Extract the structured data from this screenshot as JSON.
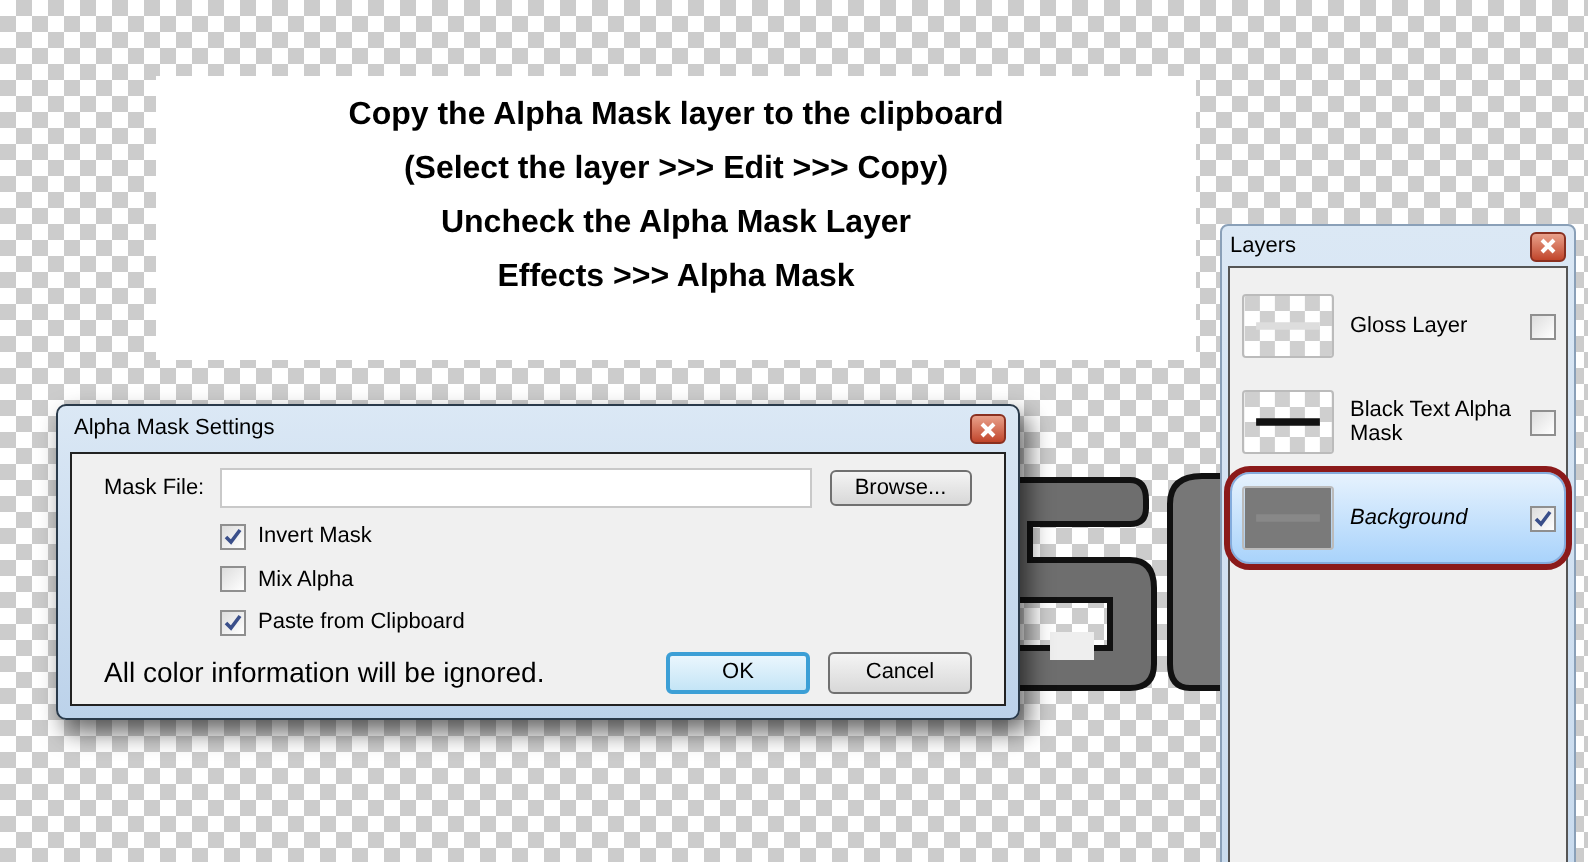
{
  "instructions": [
    "Copy the Alpha Mask layer to the clipboard",
    "(Select the layer >>> Edit >>> Copy)",
    "Uncheck the Alpha Mask Layer",
    "Effects >>> Alpha Mask"
  ],
  "dialog": {
    "title": "Alpha Mask Settings",
    "mask_file_label": "Mask File:",
    "browse_button": "Browse...",
    "options": [
      {
        "label": "Invert Mask",
        "checked": true
      },
      {
        "label": "Mix Alpha",
        "checked": false
      },
      {
        "label": "Paste from Clipboard",
        "checked": true
      }
    ],
    "note": "All color information will be ignored.",
    "buttons": [
      {
        "label": "OK",
        "default": true
      },
      {
        "label": "Cancel",
        "default": false
      }
    ]
  },
  "layers_panel": {
    "title": "Layers",
    "layers": [
      {
        "name": "Gloss Layer",
        "thumbnail": {
          "kind": "light"
        },
        "visible": false,
        "selected": false,
        "circled": false,
        "kind": "layer"
      },
      {
        "name": "Black Text Alpha Mask",
        "thumbnail": {
          "kind": "dark"
        },
        "visible": false,
        "selected": false,
        "circled": false,
        "kind": "layer"
      },
      {
        "name": "Background",
        "thumbnail": {
          "kind": "gray"
        },
        "visible": true,
        "selected": true,
        "circled": true,
        "kind": "background"
      }
    ]
  }
}
